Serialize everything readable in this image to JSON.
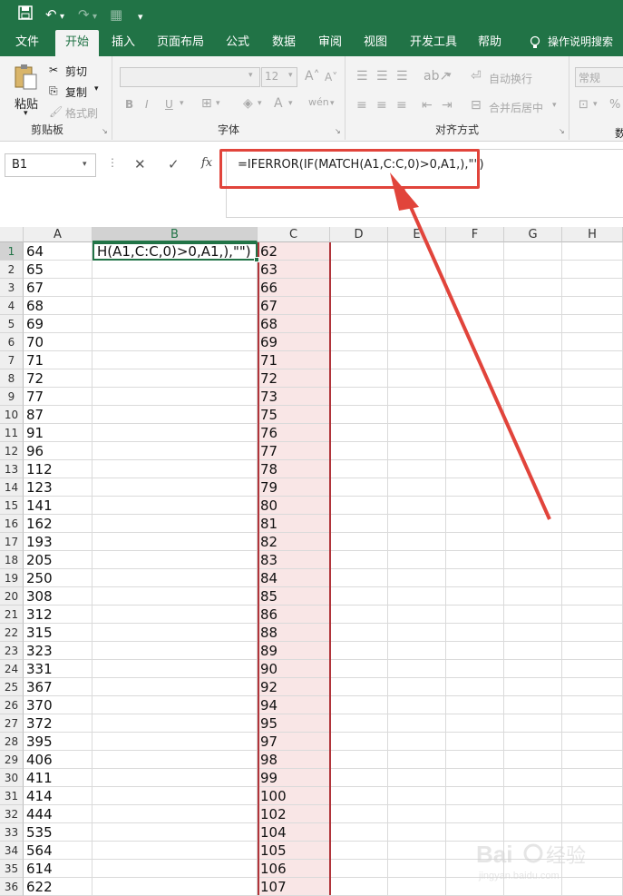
{
  "quick_access": {
    "save_icon": "save-icon",
    "undo_icon": "undo-icon",
    "redo_icon": "redo-icon",
    "more": "▾"
  },
  "tabs": [
    {
      "label": "文件",
      "active": false
    },
    {
      "label": "开始",
      "active": true
    },
    {
      "label": "插入",
      "active": false
    },
    {
      "label": "页面布局",
      "active": false
    },
    {
      "label": "公式",
      "active": false
    },
    {
      "label": "数据",
      "active": false
    },
    {
      "label": "审阅",
      "active": false
    },
    {
      "label": "视图",
      "active": false
    },
    {
      "label": "开发工具",
      "active": false
    },
    {
      "label": "帮助",
      "active": false
    }
  ],
  "tell_me": "操作说明搜索",
  "ribbon": {
    "clipboard": {
      "paste": "粘贴",
      "cut": "剪切",
      "copy": "复制",
      "format_painter": "格式刷",
      "group": "剪贴板"
    },
    "font": {
      "size": "12",
      "bold": "B",
      "italic": "I",
      "underline": "U",
      "group": "字体"
    },
    "alignment": {
      "wrap": "自动换行",
      "merge": "合并后居中",
      "group": "对齐方式"
    },
    "number": {
      "format": "常规",
      "percent": "%"
    }
  },
  "formula_bar": {
    "name_box": "B1",
    "cancel": "✕",
    "enter": "✓",
    "fx": "fx",
    "formula": "=IFERROR(IF(MATCH(A1,C:C,0)>0,A1,),\"\")"
  },
  "columns": [
    "A",
    "B",
    "C",
    "D",
    "E",
    "F",
    "G",
    "H"
  ],
  "active_cell_text": "H(A1,C:C,0)>0,A1,),\"\")",
  "rows": [
    {
      "n": "1",
      "a": "64",
      "c": "62"
    },
    {
      "n": "2",
      "a": "65",
      "c": "63"
    },
    {
      "n": "3",
      "a": "67",
      "c": "66"
    },
    {
      "n": "4",
      "a": "68",
      "c": "67"
    },
    {
      "n": "5",
      "a": "69",
      "c": "68"
    },
    {
      "n": "6",
      "a": "70",
      "c": "69"
    },
    {
      "n": "7",
      "a": "71",
      "c": "71"
    },
    {
      "n": "8",
      "a": "72",
      "c": "72"
    },
    {
      "n": "9",
      "a": "77",
      "c": "73"
    },
    {
      "n": "10",
      "a": "87",
      "c": "75"
    },
    {
      "n": "11",
      "a": "91",
      "c": "76"
    },
    {
      "n": "12",
      "a": "96",
      "c": "77"
    },
    {
      "n": "13",
      "a": "112",
      "c": "78"
    },
    {
      "n": "14",
      "a": "123",
      "c": "79"
    },
    {
      "n": "15",
      "a": "141",
      "c": "80"
    },
    {
      "n": "16",
      "a": "162",
      "c": "81"
    },
    {
      "n": "17",
      "a": "193",
      "c": "82"
    },
    {
      "n": "18",
      "a": "205",
      "c": "83"
    },
    {
      "n": "19",
      "a": "250",
      "c": "84"
    },
    {
      "n": "20",
      "a": "308",
      "c": "85"
    },
    {
      "n": "21",
      "a": "312",
      "c": "86"
    },
    {
      "n": "22",
      "a": "315",
      "c": "88"
    },
    {
      "n": "23",
      "a": "323",
      "c": "89"
    },
    {
      "n": "24",
      "a": "331",
      "c": "90"
    },
    {
      "n": "25",
      "a": "367",
      "c": "92"
    },
    {
      "n": "26",
      "a": "370",
      "c": "94"
    },
    {
      "n": "27",
      "a": "372",
      "c": "95"
    },
    {
      "n": "28",
      "a": "395",
      "c": "97"
    },
    {
      "n": "29",
      "a": "406",
      "c": "98"
    },
    {
      "n": "30",
      "a": "411",
      "c": "99"
    },
    {
      "n": "31",
      "a": "414",
      "c": "100"
    },
    {
      "n": "32",
      "a": "444",
      "c": "102"
    },
    {
      "n": "33",
      "a": "535",
      "c": "104"
    },
    {
      "n": "34",
      "a": "564",
      "c": "105"
    },
    {
      "n": "35",
      "a": "614",
      "c": "106"
    },
    {
      "n": "36",
      "a": "622",
      "c": "107"
    }
  ],
  "colors": {
    "excel_green": "#217346",
    "highlight_red": "#e1443b",
    "pink_fill": "#f9e6e6"
  },
  "watermark": "Baidu 经验 jingyan.baidu.com"
}
